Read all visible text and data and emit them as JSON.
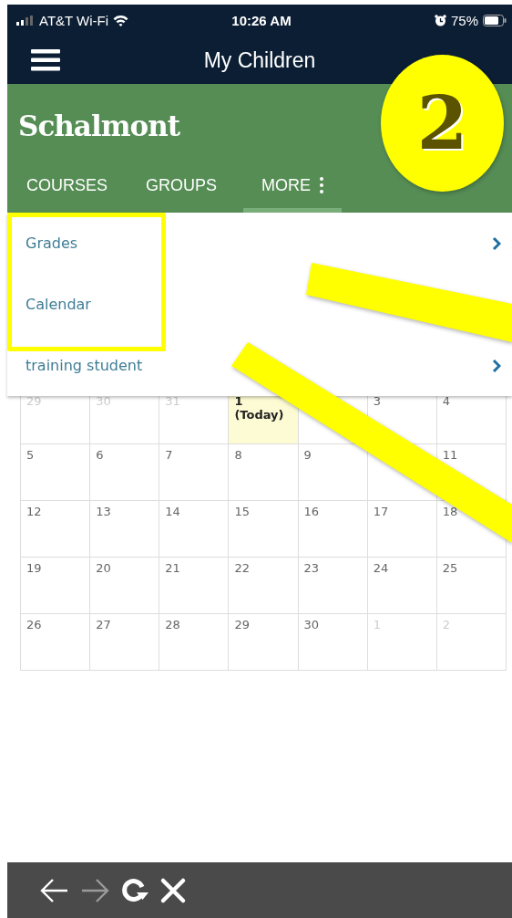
{
  "status_bar": {
    "carrier": "AT&T Wi-Fi",
    "time": "10:26 AM",
    "battery": "75%"
  },
  "header": {
    "title": "My Children"
  },
  "logo": {
    "text": "Schalmont"
  },
  "tabs": [
    {
      "label": "COURSES",
      "selected": false,
      "kind": "text"
    },
    {
      "label": "GROUPS",
      "selected": false,
      "kind": "text"
    },
    {
      "label": "MORE",
      "selected": true,
      "kind": "more"
    }
  ],
  "menu": [
    {
      "label": "Grades",
      "chevron": true
    },
    {
      "label": "Calendar",
      "chevron": false
    },
    {
      "label": "training student",
      "chevron": true
    }
  ],
  "calendar": {
    "weeks": [
      [
        {
          "day": "29",
          "muted": true,
          "today": false
        },
        {
          "day": "30",
          "muted": true,
          "today": false
        },
        {
          "day": "31",
          "muted": true,
          "today": false
        },
        {
          "day": "1 (Today)",
          "muted": false,
          "today": true
        },
        {
          "today": false
        },
        {
          "day": "3",
          "muted": false,
          "today": false
        },
        {
          "day": "4",
          "muted": false,
          "today": false
        }
      ],
      [
        {
          "day": "5",
          "muted": false,
          "today": false
        },
        {
          "day": "6",
          "muted": false,
          "today": false
        },
        {
          "day": "7",
          "muted": false,
          "today": false
        },
        {
          "day": "8",
          "muted": false,
          "today": false
        },
        {
          "day": "9",
          "muted": false,
          "today": false
        },
        {
          "today": false
        },
        {
          "day": "11",
          "muted": false,
          "today": false
        }
      ],
      [
        {
          "day": "12",
          "muted": false,
          "today": false
        },
        {
          "day": "13",
          "muted": false,
          "today": false
        },
        {
          "day": "14",
          "muted": false,
          "today": false
        },
        {
          "day": "15",
          "muted": false,
          "today": false
        },
        {
          "day": "16",
          "muted": false,
          "today": false
        },
        {
          "day": "17",
          "muted": false,
          "today": false
        },
        {
          "day": "18",
          "muted": false,
          "today": false
        }
      ],
      [
        {
          "day": "19",
          "muted": false,
          "today": false
        },
        {
          "day": "20",
          "muted": false,
          "today": false
        },
        {
          "day": "21",
          "muted": false,
          "today": false
        },
        {
          "day": "22",
          "muted": false,
          "today": false
        },
        {
          "day": "23",
          "muted": false,
          "today": false
        },
        {
          "day": "24",
          "muted": false,
          "today": false
        },
        {
          "day": "25",
          "muted": false,
          "today": false
        }
      ],
      [
        {
          "day": "26",
          "muted": false,
          "today": false
        },
        {
          "day": "27",
          "muted": false,
          "today": false
        },
        {
          "day": "28",
          "muted": false,
          "today": false
        },
        {
          "day": "29",
          "muted": false,
          "today": false
        },
        {
          "day": "30",
          "muted": false,
          "today": false
        },
        {
          "day": "1",
          "muted": true,
          "today": false
        },
        {
          "day": "2",
          "muted": true,
          "today": false
        }
      ]
    ]
  },
  "browser_bar": [
    {
      "kind": "back",
      "disabled": false
    },
    {
      "kind": "forward",
      "disabled": true
    },
    {
      "kind": "reload",
      "disabled": false
    },
    {
      "kind": "close",
      "disabled": false
    }
  ],
  "annotation": {
    "badge": "2"
  }
}
